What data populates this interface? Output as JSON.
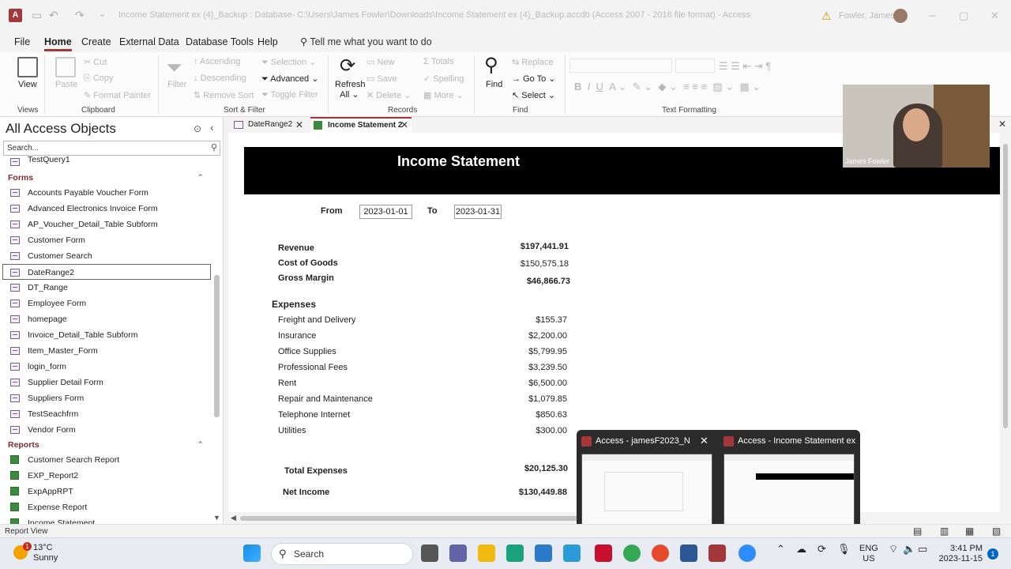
{
  "window": {
    "title": "Income Statement ex (4)_Backup : Database- C:\\Users\\James Fowler\\Downloads\\Income Statement ex (4)_Backup.accdb (Access 2007 - 2016 file format)  -  Access",
    "app_icon": "A",
    "user": "Fowler, James"
  },
  "menu": {
    "items": [
      "File",
      "Home",
      "Create",
      "External Data",
      "Database Tools",
      "Help"
    ],
    "active": "Home",
    "tell_me": "Tell me what you want to do"
  },
  "ribbon": {
    "views": {
      "view": "View",
      "group": "Views"
    },
    "clipboard": {
      "paste": "Paste",
      "cut": "Cut",
      "copy": "Copy",
      "format_painter": "Format Painter",
      "group": "Clipboard"
    },
    "sort_filter": {
      "filter": "Filter",
      "ascending": "Ascending",
      "descending": "Descending",
      "remove_sort": "Remove Sort",
      "selection": "Selection",
      "advanced": "Advanced",
      "toggle_filter": "Toggle Filter",
      "group": "Sort & Filter"
    },
    "records": {
      "refresh": "Refresh",
      "refresh_all": "All",
      "new": "New",
      "save": "Save",
      "delete": "Delete",
      "totals": "Totals",
      "spelling": "Spelling",
      "more": "More",
      "group": "Records"
    },
    "find": {
      "find": "Find",
      "replace": "Replace",
      "goto": "Go To",
      "select": "Select",
      "group": "Find"
    },
    "text_formatting": {
      "group": "Text Formatting"
    }
  },
  "nav": {
    "header": "All Access Objects",
    "search_placeholder": "Search...",
    "top_item": "TestQuery1",
    "forms_section": "Forms",
    "forms": [
      "Accounts Payable Voucher Form",
      "Advanced Electronics Invoice Form",
      "AP_Voucher_Detail_Table Subform",
      "Customer Form",
      "Customer Search",
      "DateRange2",
      "DT_Range",
      "Employee Form",
      "homepage",
      "Invoice_Detail_Table Subform",
      "Item_Master_Form",
      "login_form",
      "Supplier Detail Form",
      "Suppliers Form",
      "TestSeachfrm",
      "Vendor Form"
    ],
    "selected_form": "DateRange2",
    "reports_section": "Reports",
    "reports": [
      "Customer Search Report",
      "EXP_Report2",
      "ExpAppRPT",
      "Expense Report",
      "Income Statement"
    ]
  },
  "tabs": [
    {
      "label": "DateRange2",
      "active": false
    },
    {
      "label": "Income Statement 2",
      "active": true
    }
  ],
  "report": {
    "title": "Income Statement",
    "from_label": "From",
    "from_value": "2023-01-01",
    "to_label": "To",
    "to_value": "2023-01-31",
    "revenue_label": "Revenue",
    "revenue": "$197,441.91",
    "cogs_label": "Cost of Goods",
    "cogs": "$150,575.18",
    "gross_margin_label": "Gross Margin",
    "gross_margin": "$46,866.73",
    "expenses_header": "Expenses",
    "expenses": [
      {
        "label": "Freight and Delivery",
        "value": "$155.37"
      },
      {
        "label": "Insurance",
        "value": "$2,200.00"
      },
      {
        "label": "Office Supplies",
        "value": "$5,799.95"
      },
      {
        "label": "Professional Fees",
        "value": "$3,239.50"
      },
      {
        "label": "Rent",
        "value": "$6,500.00"
      },
      {
        "label": "Repair and Maintenance",
        "value": "$1,079.85"
      },
      {
        "label": "Telephone Internet",
        "value": "$850.63"
      },
      {
        "label": "Utilities",
        "value": "$300.00"
      }
    ],
    "total_expenses_label": "Total Expenses",
    "total_expenses": "$20,125.30",
    "net_income_label": "Net Income",
    "net_income": "$130,449.88"
  },
  "status": {
    "text": "Report View"
  },
  "webcam": {
    "name": "James Fowler"
  },
  "taskbar_preview": [
    {
      "title": "Access - jamesF2023_No..."
    },
    {
      "title": "Access - Income Statement ex (..."
    }
  ],
  "taskbar": {
    "weather_temp": "13°C",
    "weather_desc": "Sunny",
    "weather_badge": "1",
    "search": "Search",
    "lang1": "ENG",
    "lang2": "US",
    "time": "3:41 PM",
    "date": "2023-11-15",
    "notifications": "1"
  },
  "colors": {
    "accent": "#a4373a",
    "report_header": "#000000",
    "taskbar": "#e8ecf2"
  }
}
